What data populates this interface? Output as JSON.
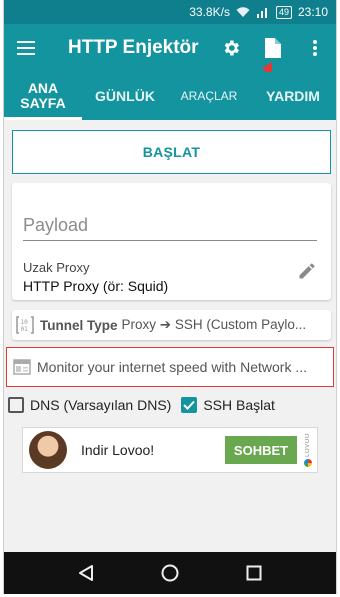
{
  "status": {
    "speed": "33.8K/s",
    "battery": "49",
    "time": "23:10"
  },
  "appbar": {
    "title": "HTTP Enjektör",
    "icons": [
      "menu-icon",
      "gear-icon",
      "document-icon",
      "more-vert-icon"
    ]
  },
  "tabs": [
    {
      "line1": "ANA",
      "line2": "SAYFA"
    },
    {
      "label": "GÜNLÜK"
    },
    {
      "label": "ARAÇLAR"
    },
    {
      "label": "YARDIM"
    }
  ],
  "main": {
    "start_label": "BAŞLAT",
    "payload_placeholder": "Payload",
    "proxy_label": "Uzak Proxy",
    "proxy_value": "HTTP Proxy (ör: Squid)",
    "tunnel_type_label": "Tunnel Type",
    "tunnel_type_value": "Proxy ➔ SSH (Custom Paylo...",
    "banner_text": "Monitor your internet speed with Network ...",
    "dns_label": "DNS (Varsayılan DNS)",
    "ssh_label": "SSH Başlat",
    "dns_checked": false,
    "ssh_checked": true
  },
  "ad": {
    "text": "Indir Lovoo!",
    "button": "SOHBET",
    "brand": "LOVOO"
  },
  "colors": {
    "primary": "#14949f",
    "status": "#0f7f8e",
    "highlight": "#e53935",
    "ad_button": "#6aa84f"
  }
}
